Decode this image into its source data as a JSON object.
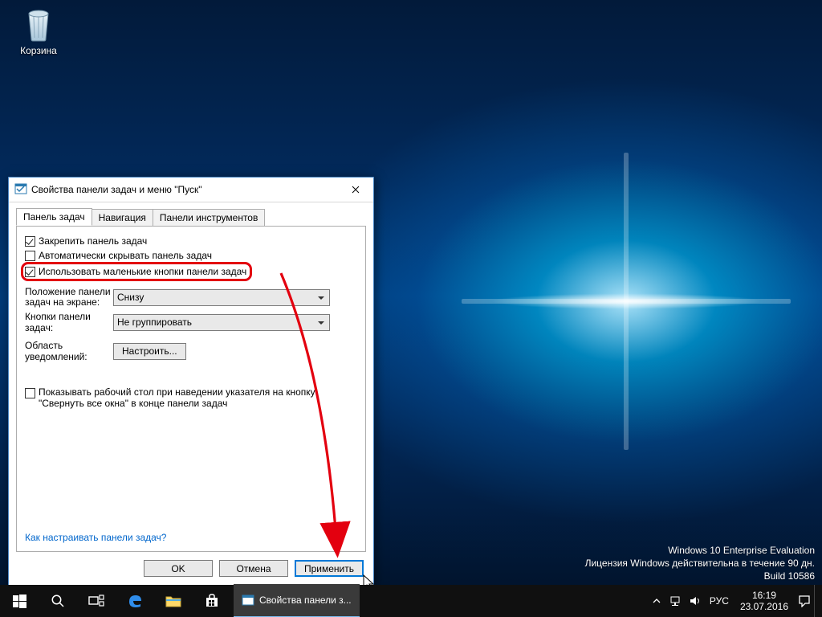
{
  "desktop": {
    "recycle_bin_label": "Корзина"
  },
  "watermark": {
    "line1": "Windows 10 Enterprise Evaluation",
    "line2": "Лицензия Windows действительна в течение 90 дн.",
    "line3": "Build 10586"
  },
  "taskbar": {
    "app_title": "Свойства панели з...",
    "lang": "РУС",
    "time": "16:19",
    "date": "23.07.2016"
  },
  "dialog": {
    "title": "Свойства панели задач и меню \"Пуск\"",
    "tabs": {
      "t1": "Панель задач",
      "t2": "Навигация",
      "t3": "Панели инструментов"
    },
    "chk_lock": "Закрепить панель задач",
    "chk_autohide": "Автоматически скрывать панель задач",
    "chk_smallbtns": "Использовать маленькие кнопки панели задач",
    "lbl_position": "Положение панели задач на экране:",
    "combo_position": "Снизу",
    "lbl_buttons": "Кнопки панели задач:",
    "combo_buttons": "Не группировать",
    "lbl_notify": "Область уведомлений:",
    "btn_notify": "Настроить...",
    "chk_peek": "Показывать рабочий стол при наведении указателя на кнопку \"Свернуть все окна\" в конце панели задач",
    "link_help": "Как настраивать панели задач?",
    "btn_ok": "OK",
    "btn_cancel": "Отмена",
    "btn_apply": "Применить"
  }
}
